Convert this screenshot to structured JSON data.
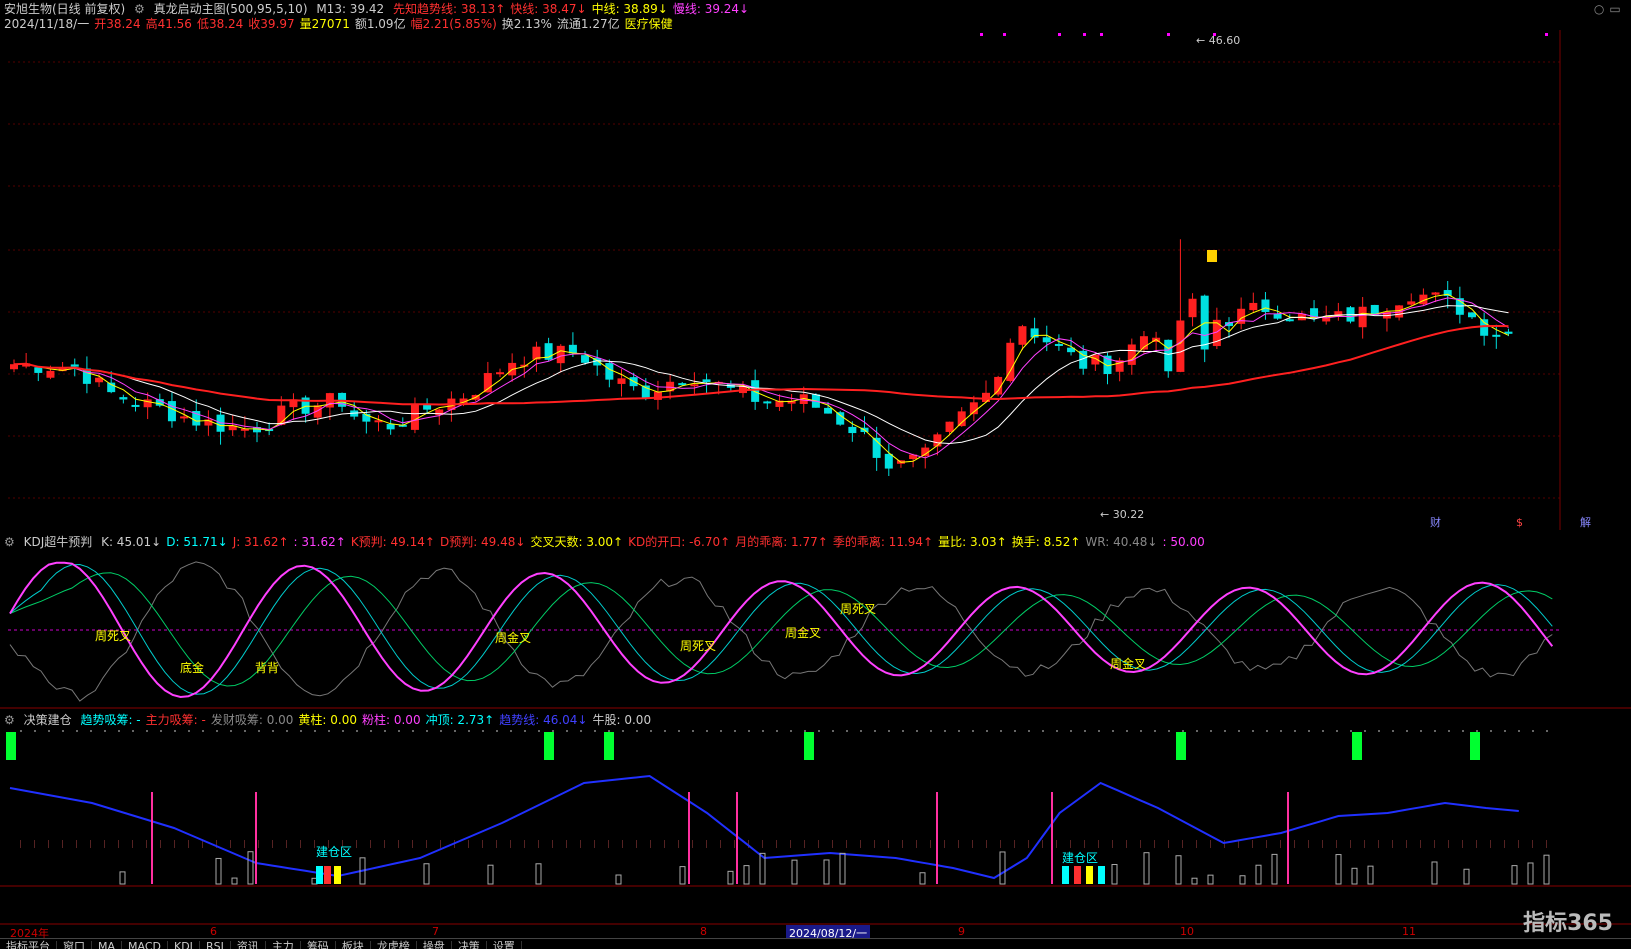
{
  "main": {
    "stock": "安旭生物(日线 前复权)",
    "indicator": "真龙启动主图(500,95,5,10)",
    "m13": "M13: 39.42",
    "lines": [
      {
        "label": "先知趋势线: 38.13↑",
        "color": "#ff3030"
      },
      {
        "label": "快线: 38.47↓",
        "color": "#ff3030"
      },
      {
        "label": "中线: 38.89↓",
        "color": "#ffff00"
      },
      {
        "label": "慢线: 39.24↓",
        "color": "#ff40ff"
      }
    ],
    "row2": [
      {
        "label": "2024/11/18/一",
        "color": "#cccccc"
      },
      {
        "label": "开38.24",
        "color": "#ff3030"
      },
      {
        "label": "高41.56",
        "color": "#ff3030"
      },
      {
        "label": "低38.24",
        "color": "#ff3030"
      },
      {
        "label": "收39.97",
        "color": "#ff3030"
      },
      {
        "label": "量27071",
        "color": "#ffff00"
      },
      {
        "label": "额1.09亿",
        "color": "#cccccc"
      },
      {
        "label": "幅2.21(5.85%)",
        "color": "#ff3030"
      },
      {
        "label": "换2.13%",
        "color": "#cccccc"
      },
      {
        "label": "流通1.27亿",
        "color": "#cccccc"
      },
      {
        "label": "医疗保健",
        "color": "#ffff00"
      }
    ],
    "high_label": "46.60",
    "low_label": "30.22",
    "markers": [
      "财",
      "$",
      "解"
    ]
  },
  "kdj": {
    "title": "KDJ超牛预判",
    "items": [
      {
        "label": "K: 45.01↓",
        "color": "#cccccc"
      },
      {
        "label": "D: 51.71↓",
        "color": "#00ffff"
      },
      {
        "label": "J: 31.62↑",
        "color": "#ff3030"
      },
      {
        "label": ": 31.62↑",
        "color": "#ff40ff"
      },
      {
        "label": "K预判: 49.14↑",
        "color": "#ff3030"
      },
      {
        "label": "D预判: 49.48↓",
        "color": "#ff3030"
      },
      {
        "label": "交叉天数: 3.00↑",
        "color": "#ffff00"
      },
      {
        "label": "KD的开口: -6.70↑",
        "color": "#ff3030"
      },
      {
        "label": "月的乖离: 1.77↑",
        "color": "#ff3030"
      },
      {
        "label": "季的乖离: 11.94↑",
        "color": "#ff3030"
      },
      {
        "label": "量比: 3.03↑",
        "color": "#ffff00"
      },
      {
        "label": "换手: 8.52↑",
        "color": "#ffff00"
      },
      {
        "label": "WR: 40.48↓",
        "color": "#888888"
      },
      {
        "label": ": 50.00",
        "color": "#ff40ff"
      }
    ],
    "labels": [
      "周死叉",
      "底金",
      "背背",
      "周金叉",
      "周死叉",
      "周金叉",
      "周死叉",
      "周金叉"
    ]
  },
  "decision": {
    "title": "决策建仓",
    "items": [
      {
        "label": "趋势吸筹: -",
        "color": "#00ffff"
      },
      {
        "label": "主力吸筹: -",
        "color": "#ff3030"
      },
      {
        "label": "发财吸筹: 0.00",
        "color": "#888888"
      },
      {
        "label": "黄柱: 0.00",
        "color": "#ffff00"
      },
      {
        "label": "粉柱: 0.00",
        "color": "#ff40ff"
      },
      {
        "label": "冲顶: 2.73↑",
        "color": "#00ffff"
      },
      {
        "label": "趋势线: 46.04↓",
        "color": "#4040ff"
      },
      {
        "label": "牛股: 0.00",
        "color": "#cccccc"
      }
    ],
    "zone_label": "建仓区"
  },
  "xaxis": {
    "labels": [
      "2024年",
      "6",
      "7",
      "8",
      "2024/08/12/一",
      "9",
      "10",
      "11"
    ]
  },
  "tabs": [
    "指标平台",
    "窗口",
    "MA",
    "MACD",
    "KDJ",
    "RSI",
    "资讯",
    "主力",
    "筹码",
    "板块",
    "龙虎榜",
    "操盘",
    "决策",
    "设置"
  ],
  "watermark": "指标365",
  "colors": {
    "up": "#ff2020",
    "down": "#00e0e0",
    "ma_white": "#ffffff",
    "ma_yellow": "#ffff00",
    "ma_magenta": "#ff40ff",
    "trend_red": "#ff2020"
  }
}
